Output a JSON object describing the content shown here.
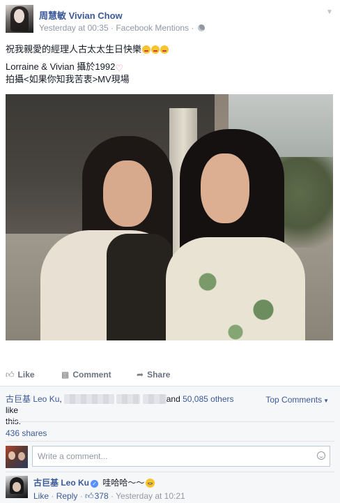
{
  "post": {
    "author": "周慧敏 Vivian Chow",
    "timestamp": "Yesterday at 00:35",
    "source": "Facebook Mentions",
    "separator": " · ",
    "privacy_icon": "globe-icon",
    "menu_icon": "chevron-down-icon",
    "line1": "祝我親愛的經理人古太太生日快樂",
    "line2": "Lorraine & Vivian 攝於1992",
    "line3": "拍攝<如果你知我苦衷>MV現場",
    "photo_alt": "photo"
  },
  "actions": {
    "like": "Like",
    "comment": "Comment",
    "share": "Share"
  },
  "likes": {
    "name1": "古巨基 Leo Ku",
    "comma": ",",
    "and": "and",
    "others": "50,085 others",
    "suffix_like": "like",
    "suffix_this": "this.",
    "top_comments": "Top Comments"
  },
  "shares": "436 shares",
  "composer": {
    "placeholder": "Write a comment..."
  },
  "comment": {
    "author": "古巨基 Leo Ku",
    "text": "哇哈哈～～",
    "like": "Like",
    "reply": "Reply",
    "like_count": "378",
    "time": "Yesterday at 10:21",
    "dot": " · "
  },
  "colors": {
    "link": "#3b5998",
    "meta": "#9197a3",
    "ufi_bg": "#f6f7f9"
  }
}
